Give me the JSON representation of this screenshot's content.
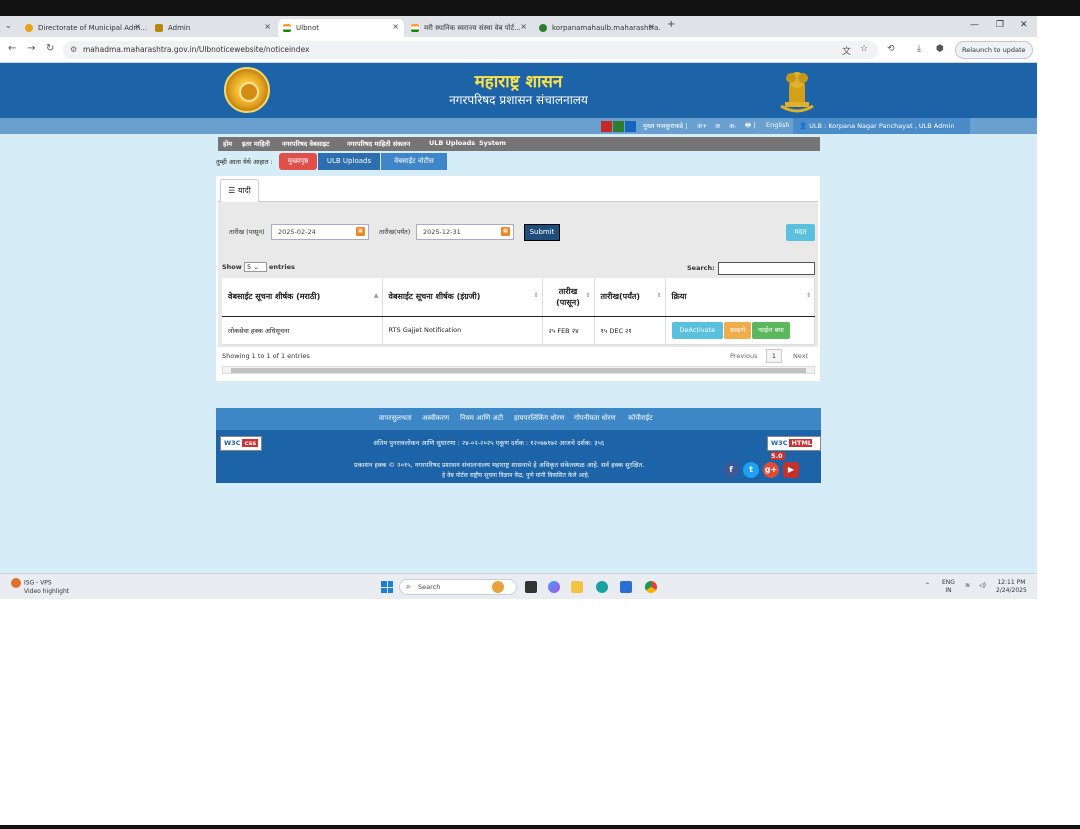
{
  "browser": {
    "tabs": [
      {
        "title": "Directorate of Municipal Adm...",
        "active": false,
        "color": "#e8a317"
      },
      {
        "title": "Admin",
        "active": false,
        "color": "#b8860b"
      },
      {
        "title": "Ulbnot",
        "active": true,
        "color": "#ff9933"
      },
      {
        "title": "मरी स्थानिक स्वराज्य संस्था वेब पोर्ट...",
        "active": false,
        "color": "#ff9933"
      },
      {
        "title": "korpanamahaulb.maharashtra...",
        "active": false,
        "color": "#2e7d32"
      }
    ],
    "url": "mahadma.maharashtra.gov.in/Ulbnoticewebsite/noticeindex",
    "relaunch_label": "Relaunch to update"
  },
  "header": {
    "title": "महाराष्ट्र शासन",
    "subtitle": "नगरपरिषद प्रशासन संचालनालय",
    "colors": {
      "primary": "#1c63a7",
      "title": "#fde14a"
    }
  },
  "utility": {
    "main_content": "मुख्य मजकूराकडे |",
    "font_plus": "अ+",
    "font_normal": "अ",
    "font_minus": "अ-",
    "print": "🖶 |",
    "language": "English",
    "ulb": "👤 ULB : Korpana Nagar Panchayat , ULB Admin",
    "swatches": [
      "#c62828",
      "#2e7d32",
      "#1565c0"
    ]
  },
  "menu": [
    "होम",
    "इतर माहिती",
    "नगरपरिषद वेबसाइट",
    "नगरपरिषद माहिती संकलन",
    "ULB Uploads",
    "System"
  ],
  "breadcrumb": {
    "lead": "तुम्ही आता येथे आहात :",
    "items": [
      "मुख्यपृष्ठ",
      "ULB Uploads",
      "वेबसाईट नोटीस"
    ]
  },
  "content": {
    "tab_label": "☰ यादी",
    "from_label": "तारीख (पासून)",
    "from_value": "2025-02-24",
    "to_label": "तारीख(पर्यंत)",
    "to_value": "2025-12-31",
    "submit_label": "Submit",
    "back_label": "मदत",
    "show_label": "Show",
    "entries_value": "5",
    "entries_label": "entries",
    "search_label": "Search:",
    "columns": [
      "वेबसाईट सूचना शीर्षक (मराठी)",
      "वेबसाईट सूचना शीर्षक (इंग्रजी)",
      "तारीख (पासून)",
      "तारीख(पर्यंत)",
      "क्रिया"
    ],
    "rows": [
      {
        "title_mr": "लोकसेवा हक्क अधिसूचना",
        "title_en": "RTS Gajjet Notification",
        "from": "२५ FEB २४",
        "to": "१५ DEC २१",
        "actions": [
          "DeActivate",
          "काढणे",
          "फाईल बघा"
        ]
      }
    ],
    "showing_text": "Showing 1 to 1 of 1 entries",
    "prev_label": "Previous",
    "page_number": "1",
    "next_label": "Next"
  },
  "footer": {
    "links": [
      "वापरसुलभता",
      "अस्वीकरण",
      "नियम आणि अटी",
      "हायपरलिंकिंग धोरण",
      "गोपनीयता धोरण",
      "कॉपीराईट"
    ],
    "updated": "अंतिम पुनरावलोकन आणि सुधारणा : २४-०२-२०२५   एकूण दर्शक : १२०७७१७२   आजचे दर्शक: ३५६",
    "copyright": "प्रकाशन हक्क © २०१५, नगरपरिषद प्रशासन संचालनालय महाराष्ट्र शासनाचे हे अधिकृत संकेतस्थळ आहे. सर्व हक्क सुरक्षित.",
    "nic": "हे वेब पोर्टल राष्ट्रीय सूचना विज्ञान केंद्र, पुणे यांनी विकसित केले आहे.",
    "w3c_css": "W3C",
    "css_tag": "css",
    "w3c_html": "W3C",
    "html_tag": "HTML 5.0"
  },
  "taskbar": {
    "weather_temp": "ISG - VPS",
    "weather_text": "Video highlight",
    "search_placeholder": "Search",
    "lang_top": "ENG",
    "lang_bottom": "IN",
    "time": "12:11 PM",
    "date": "2/24/2025"
  }
}
